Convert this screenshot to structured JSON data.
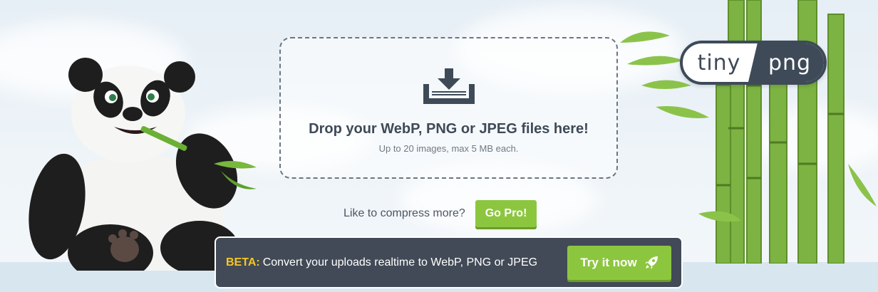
{
  "logo": {
    "left": "tiny",
    "right": "png"
  },
  "dropzone": {
    "title": "Drop your WebP, PNG or JPEG files here!",
    "subtitle": "Up to 20 images, max 5 MB each."
  },
  "pro": {
    "text": "Like to compress more?",
    "button": "Go Pro!"
  },
  "beta": {
    "label": "BETA:",
    "text": "Convert your uploads realtime to WebP, PNG or JPEG",
    "button": "Try it now"
  },
  "colors": {
    "accent_green": "#8cc63f",
    "dark": "#424a57",
    "beta_yellow": "#f5c722"
  },
  "icons": [
    "download-tray-icon",
    "rocket-icon"
  ]
}
